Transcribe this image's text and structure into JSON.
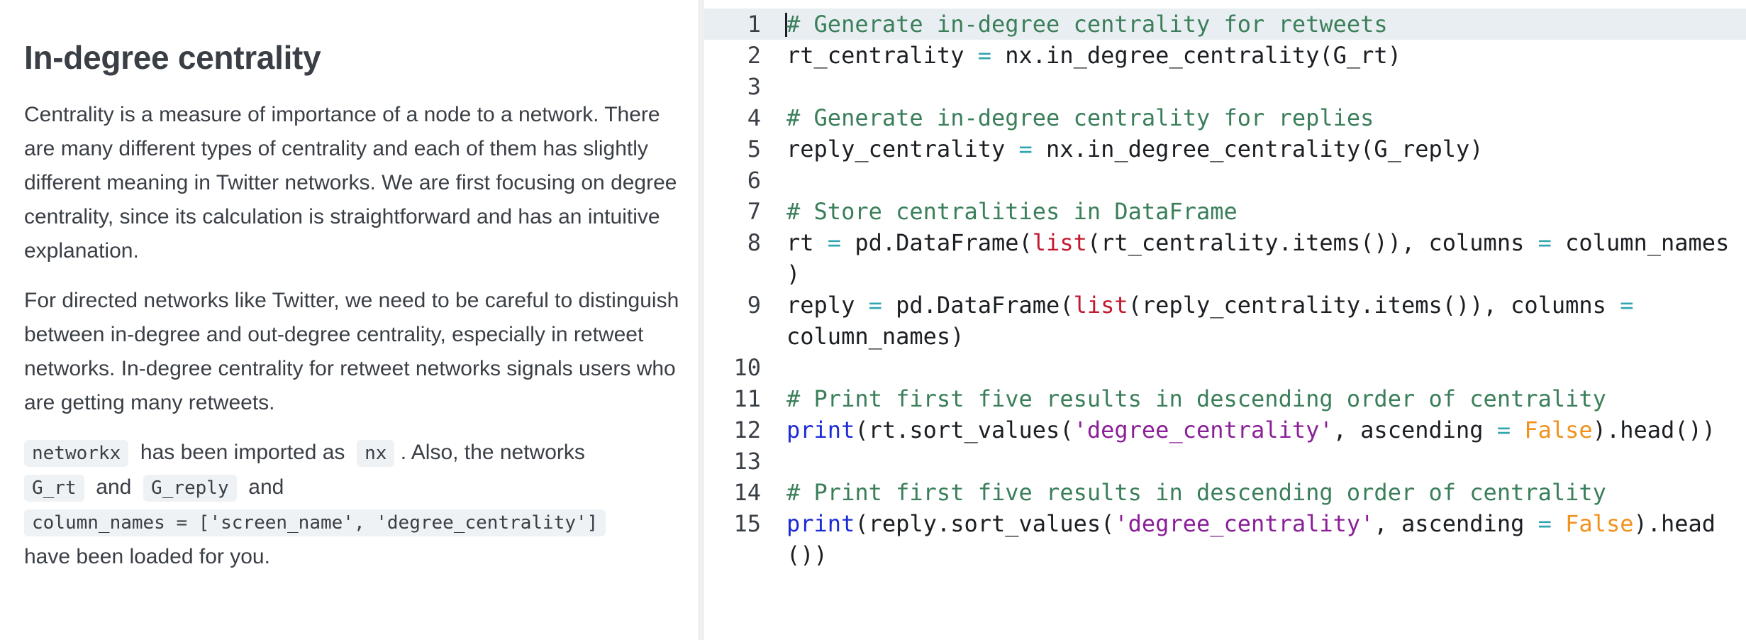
{
  "instructions": {
    "title": "In-degree centrality",
    "para1": "Centrality is a measure of importance of a node to a network. There are many different types of centrality and each of them has slightly different meaning in Twitter networks. We are first focusing on degree centrality, since its calculation is straightforward and has an intuitive explanation.",
    "para2": "For directed networks like Twitter, we need to be careful to distinguish between in-degree and out-degree centrality, especially in retweet networks. In-degree centrality for retweet networks signals users who are getting many retweets.",
    "para3": {
      "chip_networkx": "networkx",
      "text_imported": "has been imported as",
      "chip_nx": "nx",
      "text_also": ". Also, the networks",
      "chip_grt": "G_rt",
      "text_and1": "and",
      "chip_greply": "G_reply",
      "text_and2": "and",
      "chip_colnames": "column_names = ['screen_name', 'degree_centrality']",
      "text_loaded": "have been loaded for you."
    }
  },
  "editor": {
    "active_line": 1,
    "lines": [
      {
        "n": "1",
        "tokens": [
          [
            "com",
            "# Generate in-degree centrality for retweets"
          ]
        ]
      },
      {
        "n": "2",
        "tokens": [
          [
            "pl",
            "rt_centrality "
          ],
          [
            "op",
            "="
          ],
          [
            "pl",
            " nx.in_degree_centrality(G_rt)"
          ]
        ]
      },
      {
        "n": "3",
        "tokens": []
      },
      {
        "n": "4",
        "tokens": [
          [
            "com",
            "# Generate in-degree centrality for replies"
          ]
        ]
      },
      {
        "n": "5",
        "tokens": [
          [
            "pl",
            "reply_centrality "
          ],
          [
            "op",
            "="
          ],
          [
            "pl",
            " nx.in_degree_centrality(G_reply)"
          ]
        ]
      },
      {
        "n": "6",
        "tokens": []
      },
      {
        "n": "7",
        "tokens": [
          [
            "com",
            "# Store centralities in DataFrame"
          ]
        ]
      },
      {
        "n": "8",
        "tokens": [
          [
            "pl",
            "rt "
          ],
          [
            "op",
            "="
          ],
          [
            "pl",
            " pd.DataFrame("
          ],
          [
            "fn",
            "list"
          ],
          [
            "pl",
            "(rt_centrality.items()), columns "
          ],
          [
            "op",
            "="
          ],
          [
            "pl",
            " column_names"
          ]
        ]
      },
      {
        "n": "",
        "tokens": [
          [
            "pl",
            ")"
          ]
        ]
      },
      {
        "n": "9",
        "tokens": [
          [
            "pl",
            "reply "
          ],
          [
            "op",
            "="
          ],
          [
            "pl",
            " pd.DataFrame("
          ],
          [
            "fn",
            "list"
          ],
          [
            "pl",
            "(reply_centrality.items()), columns "
          ],
          [
            "op",
            "="
          ]
        ]
      },
      {
        "n": "",
        "tokens": [
          [
            "pl",
            "column_names)"
          ]
        ]
      },
      {
        "n": "10",
        "tokens": []
      },
      {
        "n": "11",
        "tokens": [
          [
            "com",
            "# Print first five results in descending order of centrality"
          ]
        ]
      },
      {
        "n": "12",
        "tokens": [
          [
            "kw",
            "print"
          ],
          [
            "pl",
            "(rt.sort_values("
          ],
          [
            "str",
            "'degree_centrality'"
          ],
          [
            "pl",
            ", ascending "
          ],
          [
            "op",
            "="
          ],
          [
            "pl",
            " "
          ],
          [
            "bool",
            "False"
          ],
          [
            "pl",
            ").head())"
          ]
        ]
      },
      {
        "n": "13",
        "tokens": []
      },
      {
        "n": "14",
        "tokens": [
          [
            "com",
            "# Print first five results in descending order of centrality"
          ]
        ]
      },
      {
        "n": "15",
        "tokens": [
          [
            "kw",
            "print"
          ],
          [
            "pl",
            "(reply.sort_values("
          ],
          [
            "str",
            "'degree_centrality'"
          ],
          [
            "pl",
            ", ascending "
          ],
          [
            "op",
            "="
          ],
          [
            "pl",
            " "
          ],
          [
            "bool",
            "False"
          ],
          [
            "pl",
            ").head"
          ]
        ]
      },
      {
        "n": "",
        "tokens": [
          [
            "pl",
            "())"
          ]
        ]
      }
    ]
  }
}
